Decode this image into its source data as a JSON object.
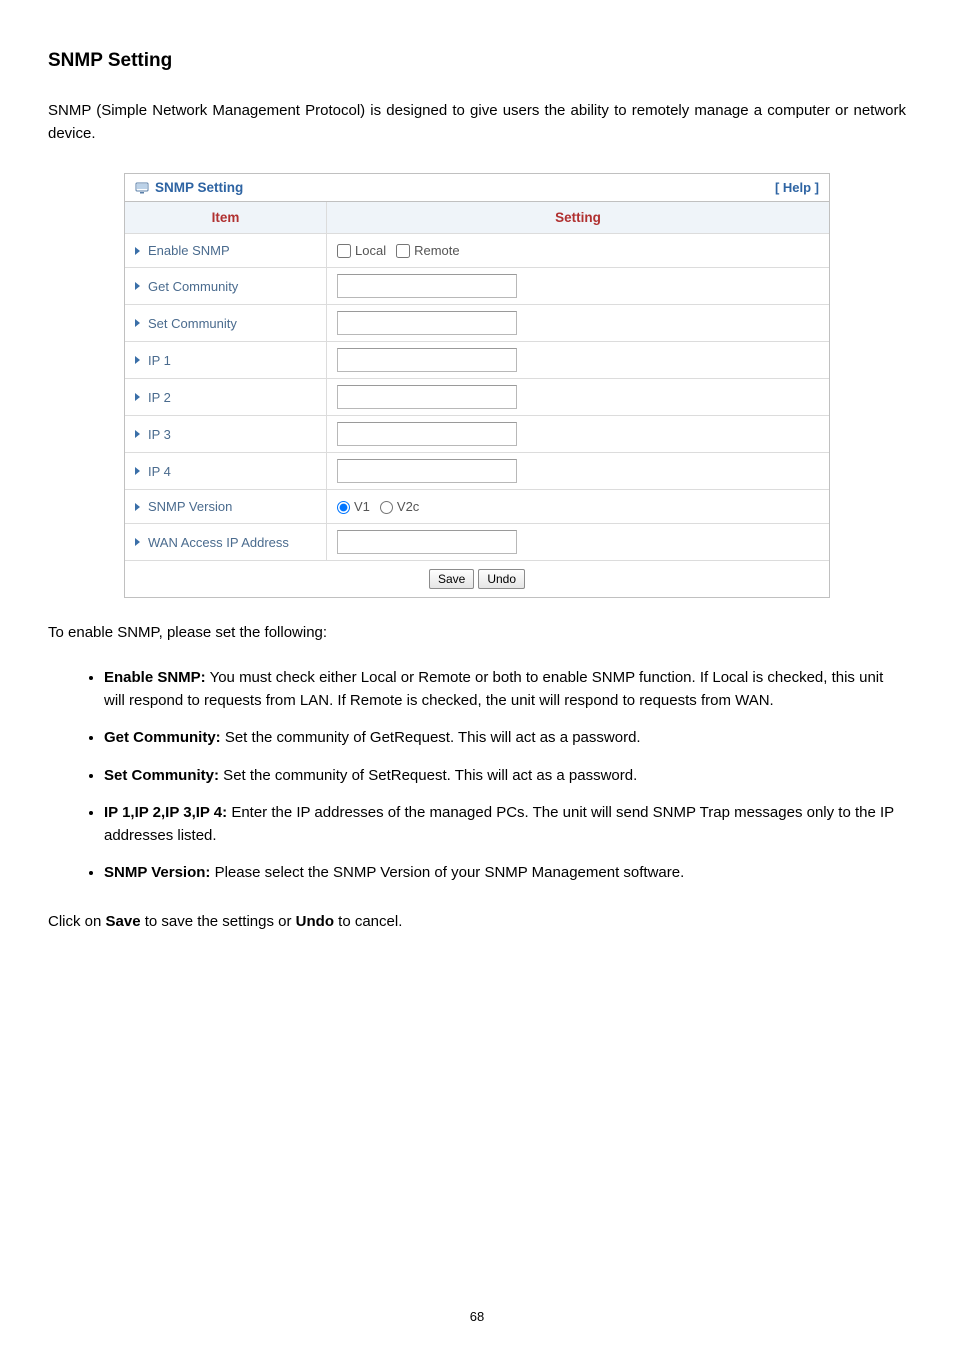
{
  "title": "SNMP Setting",
  "intro": "SNMP (Simple Network Management Protocol) is designed to give users the ability to remotely manage a computer or network device.",
  "panel": {
    "header": "SNMP Setting",
    "help": "[ Help ]",
    "col_item": "Item",
    "col_setting": "Setting",
    "rows": {
      "enable_snmp": "Enable SNMP",
      "local_label": "Local",
      "remote_label": "Remote",
      "get_community": "Get Community",
      "set_community": "Set Community",
      "ip1": "IP 1",
      "ip2": "IP 2",
      "ip3": "IP 3",
      "ip4": "IP 4",
      "snmp_version": "SNMP Version",
      "v1_label": "V1",
      "v2c_label": "V2c",
      "wan_access": "WAN Access IP Address"
    },
    "save": "Save",
    "undo": "Undo"
  },
  "sub_intro": "To enable SNMP, please set the following:",
  "bullets": {
    "b0_bold": "Enable SNMP:",
    "b0_text": " You must check either Local or Remote or both to enable SNMP function. If Local is checked, this unit will respond to requests from LAN. If Remote is checked, the unit will respond to requests from WAN.",
    "b1_bold": "Get Community:",
    "b1_text": " Set the community of GetRequest. This will act as a password.",
    "b2_bold": "Set Community:",
    "b2_text": " Set the community of SetRequest. This will act as a password.",
    "b3_bold": "IP 1,IP 2,IP 3,IP 4:",
    "b3_text": " Enter the IP addresses of the managed PCs. The unit will send SNMP Trap messages only to the IP addresses listed.",
    "b4_bold": "SNMP Version:",
    "b4_text": " Please select the SNMP Version of your SNMP Management software."
  },
  "closing_pre": "Click on ",
  "closing_save": "Save",
  "closing_mid": " to save the settings or ",
  "closing_undo": "Undo",
  "closing_post": " to cancel.",
  "page_num": "68"
}
